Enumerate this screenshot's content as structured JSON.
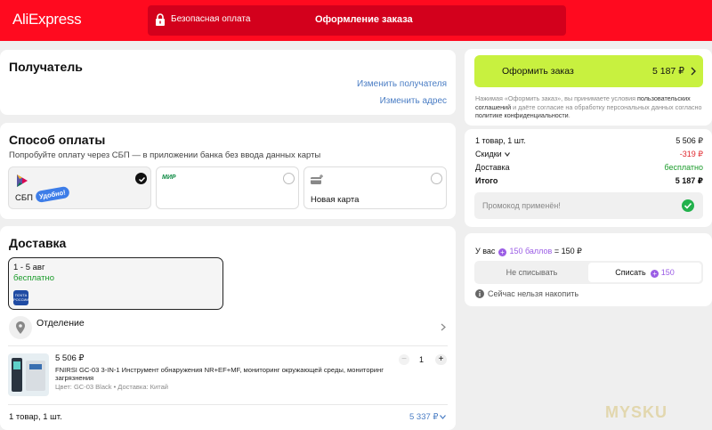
{
  "header": {
    "logo": "AliExpress",
    "secure_payment": "Безопасная оплата",
    "checkout_title": "Оформление заказа"
  },
  "recipient": {
    "title": "Получатель",
    "change_recipient": "Изменить получателя",
    "change_address": "Изменить адрес"
  },
  "payment": {
    "title": "Способ оплаты",
    "subtitle": "Попробуйте оплату через СБП — в приложении банка без ввода данных карты",
    "options": [
      {
        "label": "СБП",
        "badge": "Удобно!",
        "selected": true
      },
      {
        "label": "",
        "brand": "МИР",
        "selected": false
      },
      {
        "label": "Новая карта",
        "selected": false
      }
    ]
  },
  "delivery": {
    "title": "Доставка",
    "option": {
      "dates": "1 - 5 авг",
      "price": "бесплатно",
      "carrier_logo": "ПОЧТА РОССИИ"
    },
    "pickup": {
      "label": "Отделение"
    },
    "item": {
      "price": "5 506 ₽",
      "name": "FNIRSI GC-03 3-IN-1 Инструмент обнаружения NR+EF+MF, мониторинг окружающей среды, мониторинг загрязнения",
      "meta": "Цвет: GC-03 Black • Доставка: Китай",
      "quantity": "1",
      "minus": "−",
      "plus": "+"
    },
    "footer": {
      "count": "1 товар, 1 шт.",
      "total": "5 337 ₽"
    }
  },
  "order": {
    "button_label": "Оформить заказ",
    "button_amount": "5 187 ₽",
    "terms_prefix": "Нажимая «Оформить заказ», вы принимаете условия ",
    "terms_link1": "пользовательских соглашений",
    "terms_middle": " и даёте согласие на обработку персональных данных согласно ",
    "terms_link2": "политике конфиденциальности",
    "terms_end": "."
  },
  "summary": {
    "items_label": "1 товар, 1 шт.",
    "items_value": "5 506 ₽",
    "discount_label": "Скидки",
    "discount_value": "-319 ₽",
    "delivery_label": "Доставка",
    "delivery_value": "бесплатно",
    "total_label": "Итого",
    "total_value": "5 187 ₽",
    "promo": "Промокод применён!"
  },
  "points": {
    "prefix": "У вас",
    "amount": "150 баллов",
    "equals": "= 150 ₽",
    "no_spend": "Не списывать",
    "spend_label": "Списать",
    "spend_amount": "150",
    "info": "Сейчас нельзя накопить"
  },
  "colors": {
    "header_red": "#ff0a1f",
    "secure_bar": "#d3001c",
    "order_button": "#c8f13f",
    "free_green": "#1a9b2a",
    "discount_red": "#e0282e",
    "points_purple": "#9b5de5",
    "link_blue": "#4a7dc4"
  },
  "watermark": "MYSKU"
}
